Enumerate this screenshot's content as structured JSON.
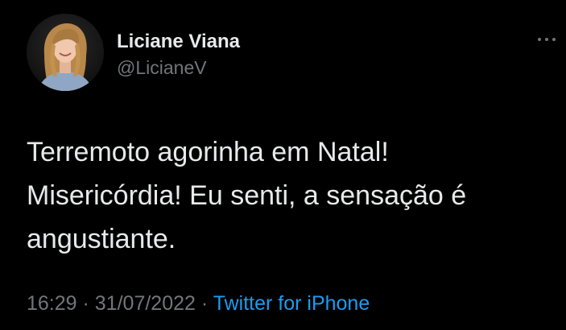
{
  "author": {
    "display_name": "Liciane Viana",
    "handle": "@LicianeV"
  },
  "tweet": {
    "lines": [
      "Terremoto agorinha em Natal!",
      "Misericórdia! Eu senti, a sensação é",
      "angustiante."
    ]
  },
  "meta": {
    "time": "16:29",
    "separator": "·",
    "date": "31/07/2022",
    "source": "Twitter for iPhone"
  },
  "icons": {
    "more": "more-options-icon",
    "avatar": "avatar"
  },
  "colors": {
    "background": "#000000",
    "primary_text": "#e7e9ea",
    "secondary_text": "#71767b",
    "link": "#1d9bf0"
  }
}
